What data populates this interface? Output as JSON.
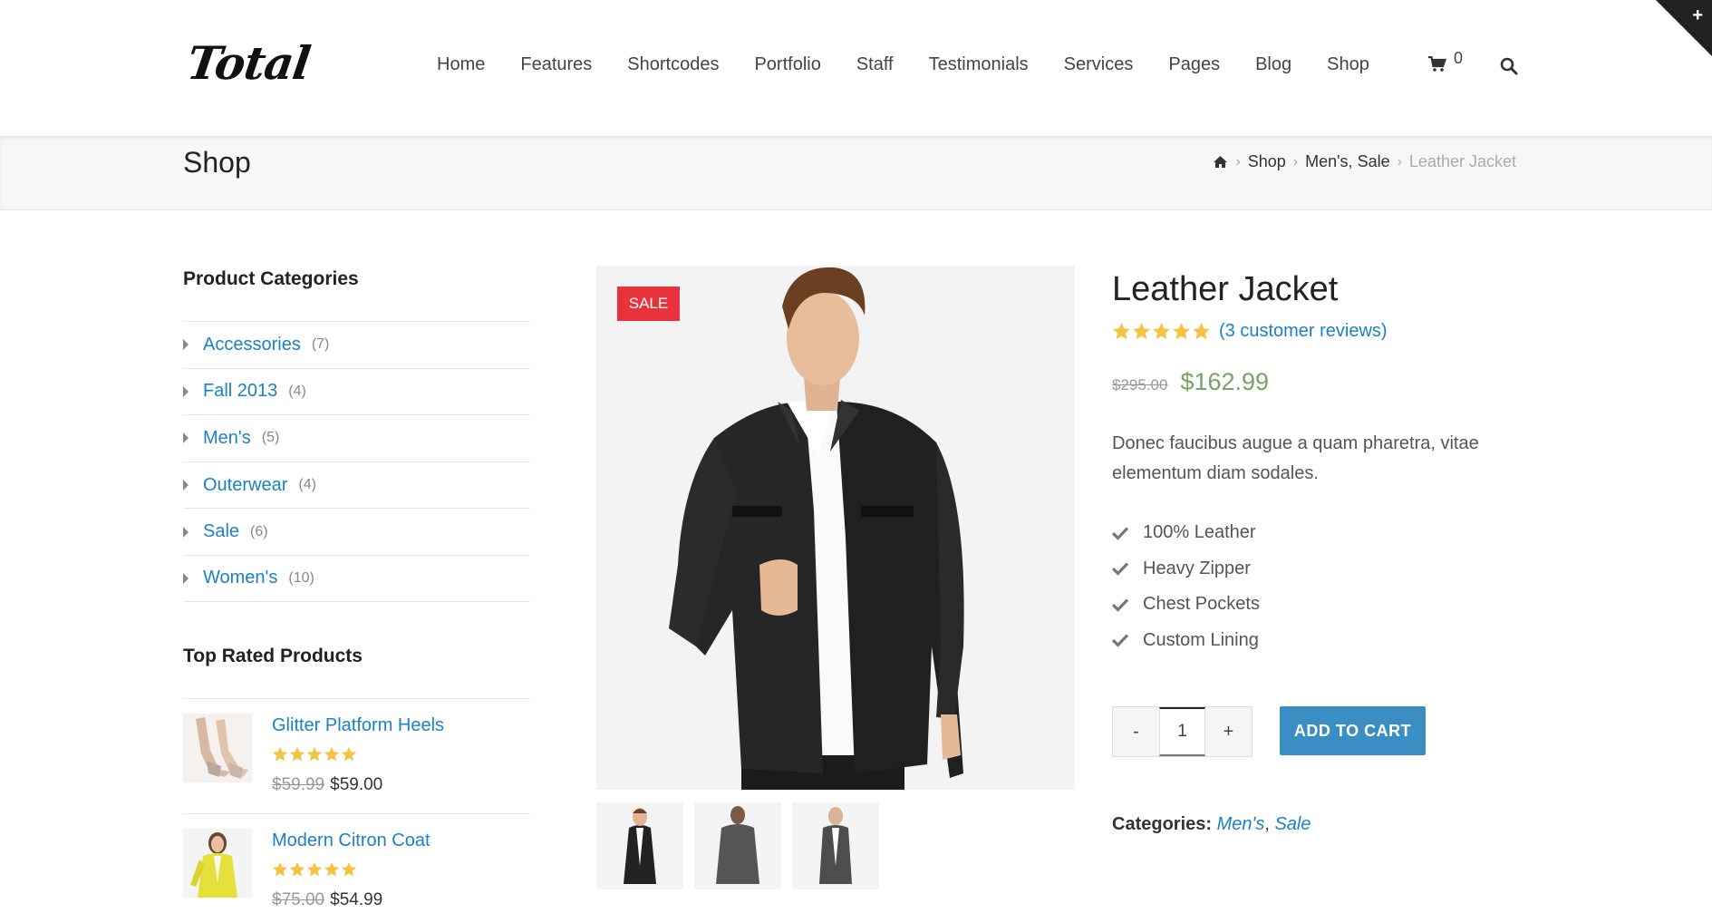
{
  "brand": {
    "logo_text": "Total"
  },
  "nav": {
    "items": [
      "Home",
      "Features",
      "Shortcodes",
      "Portfolio",
      "Staff",
      "Testimonials",
      "Services",
      "Pages",
      "Blog",
      "Shop"
    ],
    "cart_count": "0"
  },
  "page_title": "Shop",
  "breadcrumb": {
    "shop": "Shop",
    "mens": "Men's",
    "comma": ",",
    "sale": "Sale",
    "current": "Leather Jacket"
  },
  "sidebar": {
    "categories_heading": "Product Categories",
    "categories": [
      {
        "label": "Accessories",
        "count": "(7)"
      },
      {
        "label": "Fall 2013",
        "count": "(4)"
      },
      {
        "label": "Men's",
        "count": "(5)"
      },
      {
        "label": "Outerwear",
        "count": "(4)"
      },
      {
        "label": "Sale",
        "count": "(6)"
      },
      {
        "label": "Women's",
        "count": "(10)"
      }
    ],
    "top_rated_heading": "Top Rated Products",
    "top_rated": [
      {
        "name": "Glitter Platform Heels",
        "old_price": "$59.99",
        "price": "$59.00",
        "rating": 5
      },
      {
        "name": "Modern Citron Coat",
        "old_price": "$75.00",
        "price": "$54.99",
        "rating": 5
      }
    ]
  },
  "product": {
    "badge": "SALE",
    "title": "Leather Jacket",
    "rating": 5,
    "reviews_label": "(3 customer reviews)",
    "old_price": "$295.00",
    "price": "$162.99",
    "description": "Donec faucibus augue a quam pharetra, vitae elementum diam sodales.",
    "features": [
      "100% Leather",
      "Heavy Zipper",
      "Chest Pockets",
      "Custom Lining"
    ],
    "quantity": "1",
    "minus_label": "-",
    "plus_label": "+",
    "add_to_cart_label": "ADD TO CART",
    "categories_label": "Categories:",
    "categories": [
      "Men's",
      "Sale"
    ],
    "categories_sep": ","
  },
  "colors": {
    "link": "#1a82c4",
    "sale_badge": "#e8323c",
    "price_green": "#77a464",
    "button_blue": "#3b8ec4",
    "star": "#f5c242"
  }
}
